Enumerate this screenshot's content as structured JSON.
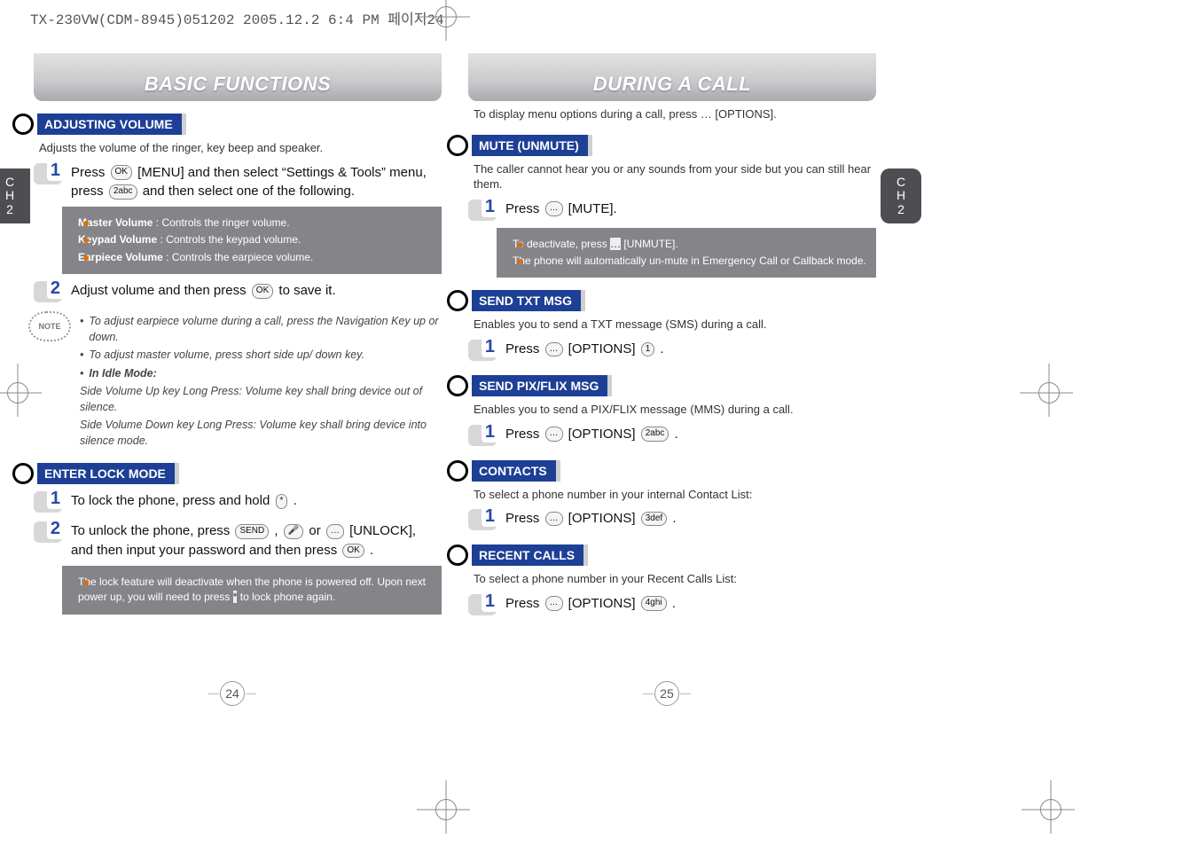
{
  "crop_header": "TX-230VW(CDM-8945)051202  2005.12.2 6:4 PM  페이지24",
  "chapter": {
    "label_top": "C",
    "label_mid": "H",
    "num": "2"
  },
  "left": {
    "title": "BASIC FUNCTIONS",
    "page_num": "24",
    "sections": {
      "adjusting": {
        "head": "ADJUSTING VOLUME",
        "desc": "Adjusts the volume of the ringer, key beep and speaker.",
        "step1": "Press      [MENU] and then select “Settings & Tools” menu, press       and then select one of the following.",
        "step1_key1": "OK",
        "step1_key2": "2abc",
        "info": [
          {
            "b": "Master Volume",
            "t": " : Controls the ringer volume."
          },
          {
            "b": "Keypad Volume",
            "t": " : Controls the keypad volume."
          },
          {
            "b": "Earpiece Volume",
            "t": " : Controls the earpiece volume."
          }
        ],
        "step2": "Adjust volume and then press       to save it.",
        "step2_key": "OK",
        "note": [
          "To adjust earpiece volume during a call, press the Navigation Key up or down.",
          "To adjust master volume, press short side up/ down key.",
          "In Idle Mode:",
          "Side Volume Up key Long Press: Volume key shall bring device out of silence.",
          "Side Volume Down key Long Press: Volume key shall bring device into silence mode."
        ]
      },
      "lock": {
        "head": "ENTER LOCK MODE",
        "step1": "To lock the phone, press and hold        .",
        "step1_key": "*",
        "step2_a": "To unlock the phone, press        ,       or       [UNLOCK], and then input your password and then press       .",
        "step2_k1": "SEND",
        "step2_k2": "🎤",
        "step2_k3": "…",
        "step2_k4": "OK",
        "info": "The lock feature will deactivate when the phone is powered off. Upon next power up, you will need to press        to lock phone again.",
        "info_key": "*"
      }
    }
  },
  "right": {
    "title": "DURING A CALL",
    "page_num": "25",
    "intro": "To display menu options during a call, press       [OPTIONS].",
    "intro_key": "…",
    "sections": {
      "mute": {
        "head": "MUTE (UNMUTE)",
        "desc": "The caller cannot hear you or any sounds from your side but you can still hear them.",
        "step1": "Press       [MUTE].",
        "step1_key": "…",
        "info": [
          "To deactivate, press       [UNMUTE].",
          "The phone will automatically un-mute in Emergency Call or Callback mode."
        ],
        "info_key": "…"
      },
      "txt": {
        "head": "SEND TXT MSG",
        "desc": "Enables you to send a TXT message (SMS) during a call.",
        "step1": "Press       [OPTIONS]        .",
        "k1": "…",
        "k2": "1"
      },
      "pix": {
        "head": "SEND PIX/FLIX MSG",
        "desc": "Enables you to send a PIX/FLIX message (MMS) during a call.",
        "step1": "Press       [OPTIONS]        .",
        "k1": "…",
        "k2": "2abc"
      },
      "contacts": {
        "head": "CONTACTS",
        "desc": "To select a phone number in your internal Contact List:",
        "step1": "Press       [OPTIONS]        .",
        "k1": "…",
        "k2": "3def"
      },
      "recent": {
        "head": "RECENT CALLS",
        "desc": "To select a phone number in your Recent Calls List:",
        "step1": "Press       [OPTIONS]        .",
        "k1": "…",
        "k2": "4ghi"
      }
    }
  }
}
